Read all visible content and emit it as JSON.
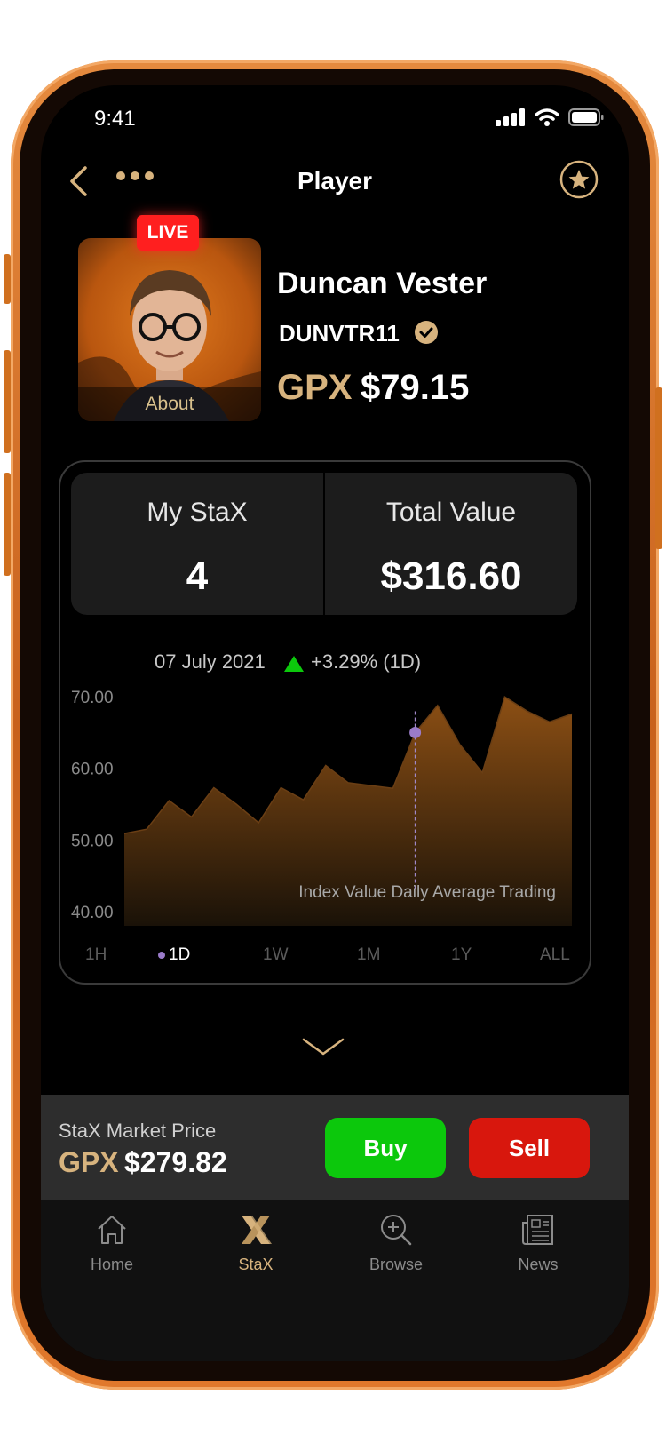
{
  "status_bar": {
    "time": "9:41"
  },
  "nav": {
    "title": "Player"
  },
  "player": {
    "live_label": "LIVE",
    "about_label": "About",
    "name": "Duncan Vester",
    "code": "DUNVTR11",
    "price_currency": "GPX",
    "price_value": "$79.15"
  },
  "stats": {
    "my_stax_label": "My StaX",
    "my_stax_value": "4",
    "total_value_label": "Total Value",
    "total_value_value": "$316.60"
  },
  "chart_data": {
    "type": "area",
    "tooltip_date": "07 July 2021",
    "tooltip_change": "+3.29% (1D)",
    "caption": "Index Value Daily Average Trading",
    "y_ticks": [
      "70.00",
      "60.00",
      "50.00",
      "40.00"
    ],
    "ylim": [
      38,
      73
    ],
    "values": [
      50.9,
      51.5,
      55.5,
      53.2,
      57.3,
      55.0,
      52.4,
      57.3,
      55.6,
      60.4,
      58.0,
      57.6,
      57.2,
      65.0,
      68.8,
      63.3,
      59.4,
      70.0,
      68.0,
      66.5,
      67.6
    ],
    "highlight_index": 13,
    "highlight_value": 65.0,
    "grid": false
  },
  "timeframes": {
    "items": [
      "1H",
      "1D",
      "1W",
      "1M",
      "1Y",
      "ALL"
    ],
    "selected": "1D"
  },
  "market": {
    "label": "StaX Market Price",
    "currency": "GPX",
    "value": "$279.82",
    "buy_label": "Buy",
    "sell_label": "Sell"
  },
  "tabs": [
    {
      "label": "Home",
      "icon": "home-icon"
    },
    {
      "label": "StaX",
      "icon": "stax-logo-icon"
    },
    {
      "label": "Browse",
      "icon": "browse-search-icon"
    },
    {
      "label": "News",
      "icon": "news-icon"
    }
  ],
  "colors": {
    "accent_gold": "#d7b37e",
    "buy_green": "#0cc80c",
    "sell_red": "#d8170d",
    "live_red": "#ff1f1f",
    "phone_orange": "#e0782c"
  }
}
